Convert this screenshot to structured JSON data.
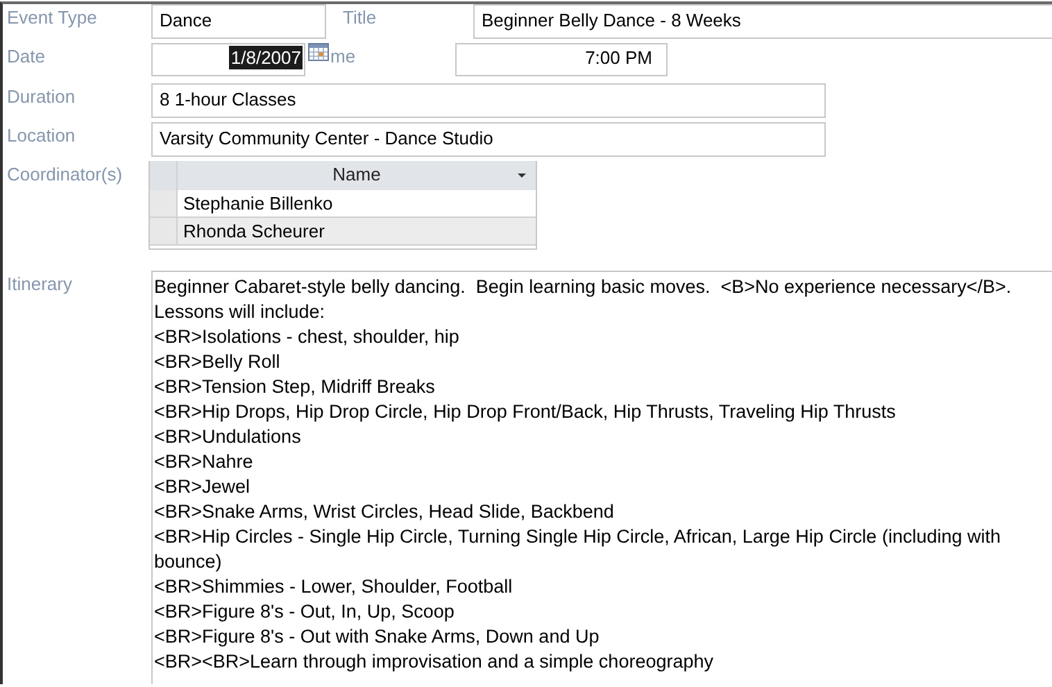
{
  "form": {
    "event_type": {
      "label": "Event Type",
      "value": "Dance"
    },
    "title": {
      "label": "Title",
      "value": "Beginner Belly Dance - 8 Weeks"
    },
    "date": {
      "label": "Date",
      "value": "1/8/2007",
      "selected": true
    },
    "time": {
      "label": "me",
      "value": "7:00 PM"
    },
    "duration": {
      "label": "Duration",
      "value": "8 1-hour Classes"
    },
    "location": {
      "label": "Location",
      "value": "Varsity Community Center - Dance Studio"
    },
    "coordinators": {
      "label": "Coordinator(s)",
      "column": "Name",
      "rows": [
        {
          "name": "Stephanie Billenko",
          "selected": false
        },
        {
          "name": "Rhonda Scheurer",
          "selected": true
        }
      ]
    },
    "itinerary": {
      "label": "Itinerary",
      "lines": [
        "Beginner Cabaret-style belly dancing.  Begin learning basic moves.  <B>No experience necessary</B>.  Lessons will include:",
        "<BR>Isolations - chest, shoulder, hip",
        "<BR>Belly Roll",
        "<BR>Tension Step, Midriff Breaks",
        "<BR>Hip Drops, Hip Drop Circle, Hip Drop Front/Back, Hip Thrusts, Traveling Hip Thrusts",
        "<BR>Undulations",
        "<BR>Nahre",
        "<BR>Jewel",
        "<BR>Snake Arms, Wrist Circles, Head Slide, Backbend",
        "<BR>Hip Circles - Single Hip Circle, Turning Single Hip Circle, African, Large Hip Circle (including with bounce)",
        "<BR>Shimmies - Lower, Shoulder, Football",
        "<BR>Figure 8's - Out, In, Up, Scoop",
        "<BR>Figure 8's - Out with Snake Arms, Down and Up",
        "<BR><BR>Learn through improvisation and a simple choreography"
      ]
    }
  }
}
